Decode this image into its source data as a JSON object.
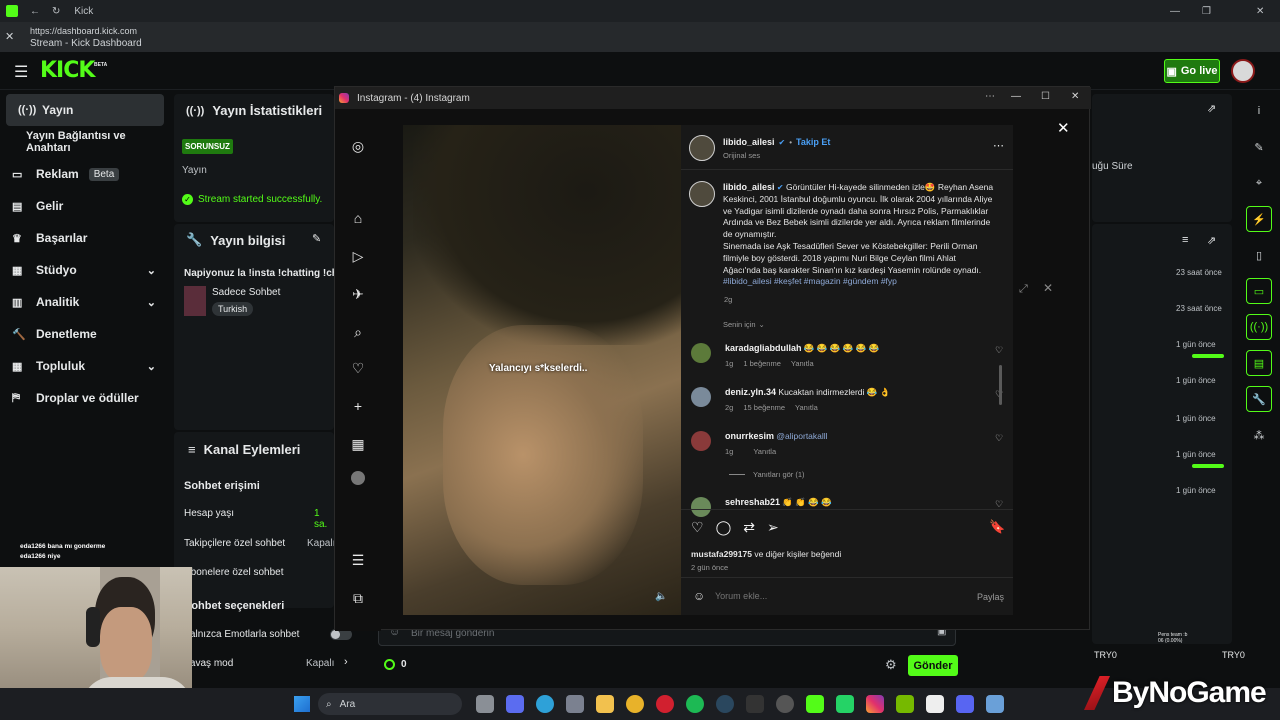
{
  "browser": {
    "tab_title": "Kick",
    "url": "https://dashboard.kick.com",
    "page_title": "Stream - Kick Dashboard"
  },
  "header": {
    "logo": "KICK",
    "logo_badge": "BETA",
    "go_live": "Go live"
  },
  "sidebar": {
    "items": [
      {
        "label": "Yayın",
        "icon": "broadcast-icon",
        "active": true
      },
      {
        "label": "Yayın Bağlantısı ve Anahtarı",
        "icon": "",
        "sub": true
      },
      {
        "label": "Reklam",
        "icon": "ad-icon",
        "badge": "Beta"
      },
      {
        "label": "Gelir",
        "icon": "revenue-icon"
      },
      {
        "label": "Başarılar",
        "icon": "trophy-icon"
      },
      {
        "label": "Stüdyo",
        "icon": "studio-icon",
        "expand": true
      },
      {
        "label": "Analitik",
        "icon": "analytics-icon",
        "expand": true
      },
      {
        "label": "Denetleme",
        "icon": "moderation-icon"
      },
      {
        "label": "Topluluk",
        "icon": "community-icon",
        "expand": true
      },
      {
        "label": "Droplar ve ödüller",
        "icon": "drops-icon"
      }
    ]
  },
  "stats": {
    "title": "Yayın İstatistikleri",
    "status_badge": "SORUNSUZ",
    "label": "Yayın",
    "success": "Stream started successfully.",
    "right_label": "uğu Süre"
  },
  "info": {
    "title": "Yayın bilgisi",
    "stream_title": "Napiyonuz la !insta !chatting !chil",
    "category": "Sadece Sohbet",
    "tag": "Turkish"
  },
  "actions": {
    "title": "Kanal Eylemleri",
    "chat_access": "Sohbet erişimi",
    "account_age": "Hesap yaşı",
    "account_age_val": "1 sa.",
    "follower_chat": "Takipçilere özel sohbet",
    "follower_chat_val": "Kapalı",
    "sub_chat": "Abonelere özel sohbet",
    "chat_options": "Sohbet seçenekleri",
    "emote_only": "Yalnızca Emotlarla sohbet",
    "slow_mode": "Yavaş mod",
    "slow_mode_val": "Kapalı"
  },
  "chat": {
    "placeholder": "Bir mesaj gönderin",
    "count": "0",
    "send": "Gönder",
    "overlay_lines": [
      "eda1266  bana mı gonderme",
      "eda1266  niye"
    ]
  },
  "activity": {
    "times": [
      "23 saat önce",
      "23 saat önce",
      "1 gün önce",
      "1 gün önce",
      "1 gün önce",
      "1 gün önce",
      "1 gün önce"
    ],
    "footer_left": "TRY0",
    "footer_right": "TRY0",
    "tiny1": "Pens team :b",
    "tiny2": "06 (0.00%)"
  },
  "instagram": {
    "window_title": "Instagram - (4) Instagram",
    "video_caption": "Yalancıyı s*kselerdi..",
    "author": "libido_ailesi",
    "follow": "Takip Et",
    "audio": "Orijinal ses",
    "caption_user": "libido_ailesi",
    "caption": "Görüntüler Hi-kayede silinmeden izle🤩 Reyhan Asena Keskinci, 2001 İstanbul doğumlu oyuncu. İlk olarak 2004 yıllarında Aliye ve Yadigar isimli dizilerde oynadı daha sonra Hırsız Polis, Parmaklıklar Ardında ve Bez Bebek isimli dizilerde yer aldı. Ayrıca reklam filmlerinde de oynamıştır.",
    "caption2": "Sinemada ise Aşk Tesadüfleri Sever ve Köstebekgiller: Perili Orman filmiyle boy gösterdi. 2018 yapımı Nuri Bilge Ceylan filmi Ahlat Ağacı'nda baş karakter Sinan'ın kız kardeşi Yasemin rolünde oynadı.",
    "hashtags": "#libido_ailesi #keşfet #magazin #gündem #fyp",
    "caption_age": "2g",
    "sort": "Senin için",
    "comments": [
      {
        "user": "karadagliabdullah",
        "text": "😂 😂 😂 😂 😂 😂",
        "age": "1g",
        "likes": "1 beğenme",
        "reply": "Yanıtla"
      },
      {
        "user": "deniz.yln.34",
        "text": "Kucaktan indirmezlerdi 😂 👌",
        "age": "2g",
        "likes": "15 beğenme",
        "reply": "Yanıtla"
      },
      {
        "user": "onurrkesim",
        "text": "@aliportakalll",
        "age": "1g",
        "likes": "",
        "reply": "Yanıtla"
      },
      {
        "user": "sehreshab21",
        "text": "👏 👏 😂 😂",
        "age": "",
        "likes": "",
        "reply": ""
      }
    ],
    "view_replies": "Yanıtları gör (1)",
    "liked_by_user": "mustafa299175",
    "liked_by_rest": " ve diğer kişiler beğendi",
    "post_age": "2 gün önce",
    "comment_placeholder": "Yorum ekle...",
    "share": "Paylaş"
  },
  "taskbar": {
    "search": "Ara"
  },
  "watermark": "ByNoGame"
}
